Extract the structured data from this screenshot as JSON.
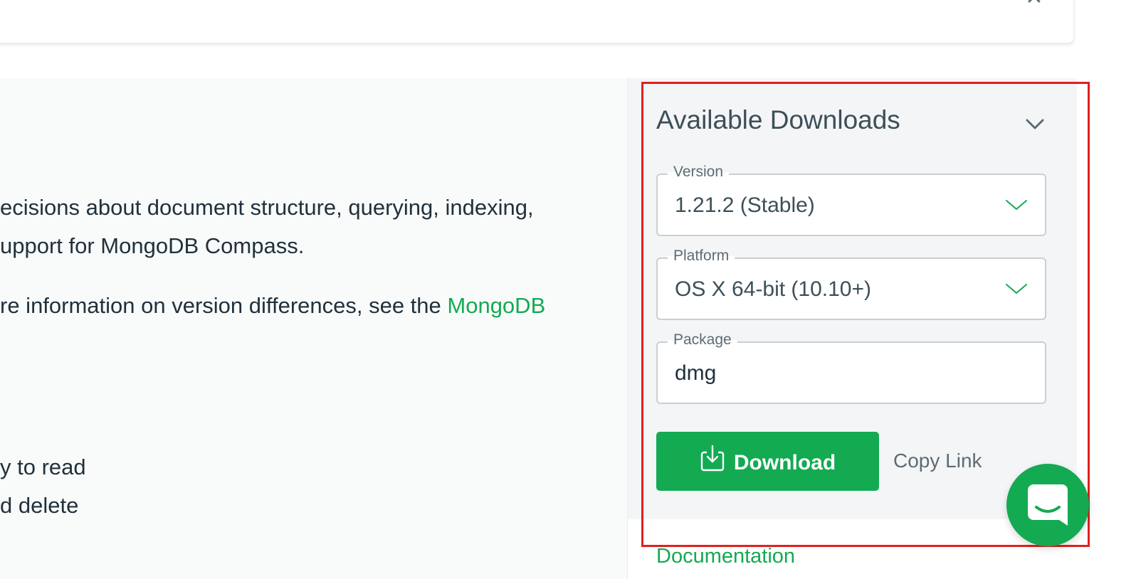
{
  "top_bar": {
    "close_icon": "close-icon"
  },
  "content": {
    "lines": [
      "ecisions about document structure, querying, indexing,",
      "upport for MongoDB Compass.",
      "re information on version differences, see the ",
      "y to read",
      "d delete"
    ],
    "link_text": "MongoDB"
  },
  "downloads": {
    "title": "Available Downloads",
    "version": {
      "label": "Version",
      "value": "1.21.2 (Stable)"
    },
    "platform": {
      "label": "Platform",
      "value": "OS X 64-bit (10.10+)"
    },
    "package": {
      "label": "Package",
      "value": "dmg"
    },
    "download_label": "Download",
    "copy_link_label": "Copy Link"
  },
  "documentation_link": "Documentation",
  "colors": {
    "accent": "#13aa52",
    "highlight": "#e02020",
    "panel_bg": "#f4f5f6"
  },
  "icons": [
    "close-icon",
    "chevron-down-icon",
    "download-icon",
    "chat-icon"
  ]
}
